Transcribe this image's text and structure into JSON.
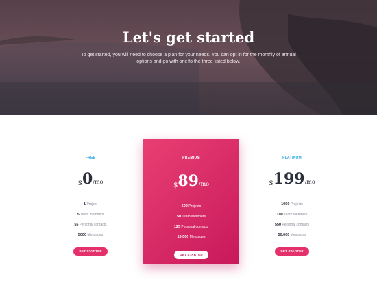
{
  "hero": {
    "title": "Let's get started",
    "subtitle": "To get started, you will need to choose a plan for your needs. You can opt in for the monthly of annual options and go with one fo the three listed below."
  },
  "colors": {
    "accent": "#e5316b",
    "plan_label": "#2aa7e1",
    "premium_gradient_start": "#e83f74",
    "premium_gradient_end": "#c8195a",
    "text_dark": "#2b2f3a"
  },
  "plans": [
    {
      "name": "FREE",
      "currency": "$",
      "amount": "0",
      "period": "/mo",
      "features": [
        {
          "value": "1",
          "label": "Project"
        },
        {
          "value": "5",
          "label": "Team members"
        },
        {
          "value": "55",
          "label": "Personal contacts"
        },
        {
          "value": "5000",
          "label": "Messages"
        }
      ],
      "button": "GET STARTED"
    },
    {
      "name": "PREMIUM",
      "currency": "$",
      "amount": "89",
      "period": "/mo",
      "features": [
        {
          "value": "500",
          "label": "Projects"
        },
        {
          "value": "50",
          "label": "Team Members"
        },
        {
          "value": "125",
          "label": "Personal contacts"
        },
        {
          "value": "15.000",
          "label": "Messages"
        }
      ],
      "button": "GET STARTED"
    },
    {
      "name": "PLATINUM",
      "currency": "$",
      "amount": "199",
      "period": "/mo",
      "features": [
        {
          "value": "1000",
          "label": "Projects"
        },
        {
          "value": "100",
          "label": "Team Members"
        },
        {
          "value": "550",
          "label": "Personal contacts"
        },
        {
          "value": "50.000",
          "label": "Messages"
        }
      ],
      "button": "GET STARTED"
    }
  ]
}
